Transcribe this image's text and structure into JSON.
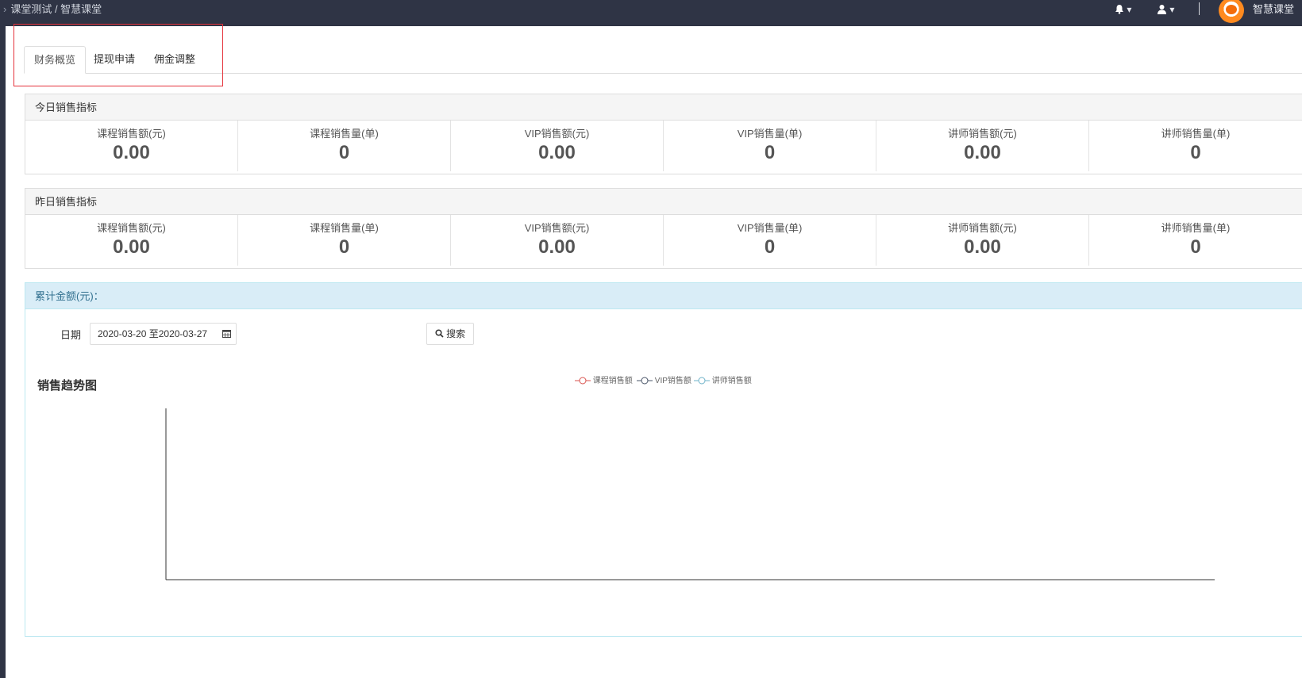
{
  "topbar": {
    "breadcrumb": "课堂测试 / 智慧课堂",
    "username": "智慧课堂",
    "bell_dropdown": "▾",
    "user_dropdown": "▾"
  },
  "tabs": [
    {
      "label": "财务概览",
      "active": true
    },
    {
      "label": "提现申请",
      "active": false
    },
    {
      "label": "佣金调整",
      "active": false
    }
  ],
  "today": {
    "title": "今日销售指标",
    "stats": [
      {
        "label": "课程销售额(元)",
        "value": "0.00"
      },
      {
        "label": "课程销售量(单)",
        "value": "0"
      },
      {
        "label": "VIP销售额(元)",
        "value": "0.00"
      },
      {
        "label": "VIP销售量(单)",
        "value": "0"
      },
      {
        "label": "讲师销售额(元)",
        "value": "0.00"
      },
      {
        "label": "讲师销售量(单)",
        "value": "0"
      }
    ]
  },
  "yesterday": {
    "title": "昨日销售指标",
    "stats": [
      {
        "label": "课程销售额(元)",
        "value": "0.00"
      },
      {
        "label": "课程销售量(单)",
        "value": "0"
      },
      {
        "label": "VIP销售额(元)",
        "value": "0.00"
      },
      {
        "label": "VIP销售量(单)",
        "value": "0"
      },
      {
        "label": "讲师销售额(元)",
        "value": "0.00"
      },
      {
        "label": "讲师销售量(单)",
        "value": "0"
      }
    ]
  },
  "cumulative": {
    "title": "累计金额(元)：",
    "date_label": "日期",
    "date_value": "2020-03-20 至2020-03-27",
    "search_label": "搜索"
  },
  "chart_data": {
    "type": "line",
    "title": "销售趋势图",
    "series": [
      {
        "name": "课程销售额",
        "color": "#d9534f",
        "values": []
      },
      {
        "name": "VIP销售额",
        "color": "#4a5568",
        "values": []
      },
      {
        "name": "讲师销售额",
        "color": "#6fb3c9",
        "values": []
      }
    ],
    "legend_position": "top-center",
    "grid": false
  },
  "icons": {
    "bell": "bell-icon",
    "user": "user-icon",
    "calendar": "calendar-icon",
    "search": "search-icon"
  }
}
